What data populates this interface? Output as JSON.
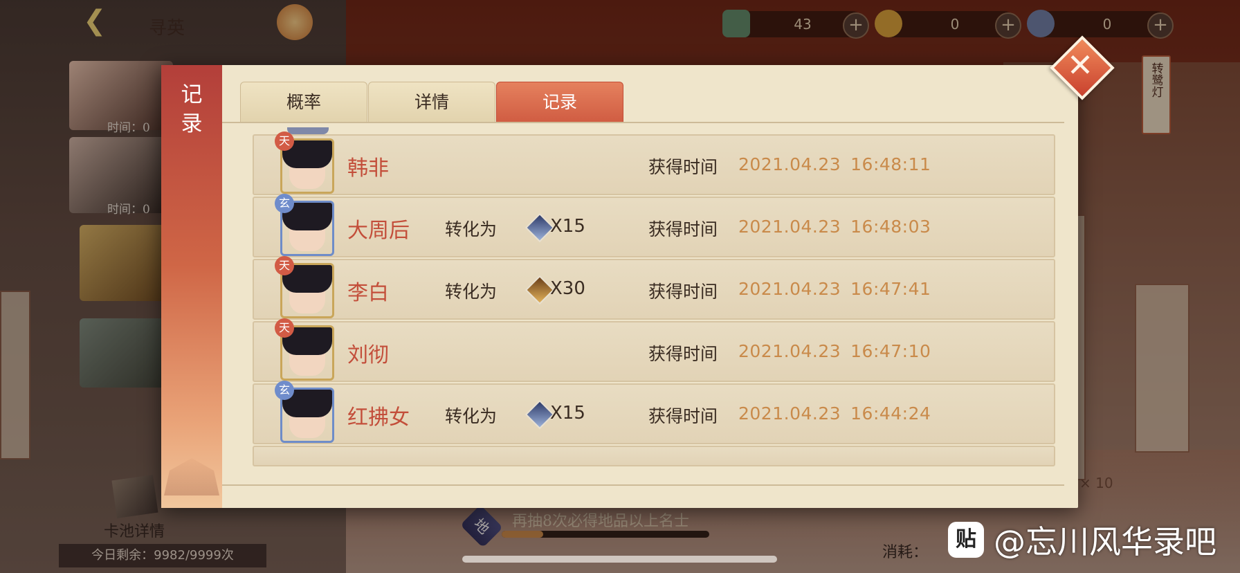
{
  "header": {
    "title": "寻英",
    "currencies": [
      {
        "icon": "jade-token-icon",
        "value": "43"
      },
      {
        "icon": "golden-lion-icon",
        "value": "0"
      },
      {
        "icon": "blue-beast-icon",
        "value": "0"
      }
    ]
  },
  "background": {
    "card_times": [
      "时间：0",
      "时间：0"
    ],
    "side_banner": "转鹭灯",
    "pool_details": "卡池详情",
    "remaining": "今日剩余：9982/9999次",
    "promo_badge": "地",
    "promo_text": "再抽8次必得地品以上名士",
    "promo_progress": 0.2,
    "cost_label": "消耗：",
    "ten_label": "× 10"
  },
  "modal": {
    "side_title": "记录",
    "tabs": [
      {
        "label": "概率",
        "active": false
      },
      {
        "label": "详情",
        "active": false
      },
      {
        "label": "记录",
        "active": true
      }
    ],
    "records": [
      {
        "tier": "天",
        "tier_type": "tian",
        "name": "韩非",
        "converted": false,
        "convert_label": "",
        "convert_qty": "",
        "time_label": "获得时间",
        "date": "2021.04.23",
        "time": "16:48:11"
      },
      {
        "tier": "玄",
        "tier_type": "xuan",
        "name": "大周后",
        "converted": true,
        "convert_label": "转化为",
        "convert_qty": "X15",
        "time_label": "获得时间",
        "date": "2021.04.23",
        "time": "16:48:03"
      },
      {
        "tier": "天",
        "tier_type": "tian",
        "name": "李白",
        "converted": true,
        "convert_label": "转化为",
        "convert_qty": "X30",
        "time_label": "获得时间",
        "date": "2021.04.23",
        "time": "16:47:41"
      },
      {
        "tier": "天",
        "tier_type": "tian",
        "name": "刘彻",
        "converted": false,
        "convert_label": "",
        "convert_qty": "",
        "time_label": "获得时间",
        "date": "2021.04.23",
        "time": "16:47:10"
      },
      {
        "tier": "玄",
        "tier_type": "xuan",
        "name": "红拂女",
        "converted": true,
        "convert_label": "转化为",
        "convert_qty": "X15",
        "time_label": "获得时间",
        "date": "2021.04.23",
        "time": "16:44:24"
      }
    ]
  },
  "watermark": {
    "logo": "贴",
    "text": "@忘川风华录吧"
  },
  "colors": {
    "accent": "#d05c42",
    "name_red": "#c34e3a",
    "time_gold": "#c98a4a",
    "panel_bg": "#efe5cb"
  }
}
